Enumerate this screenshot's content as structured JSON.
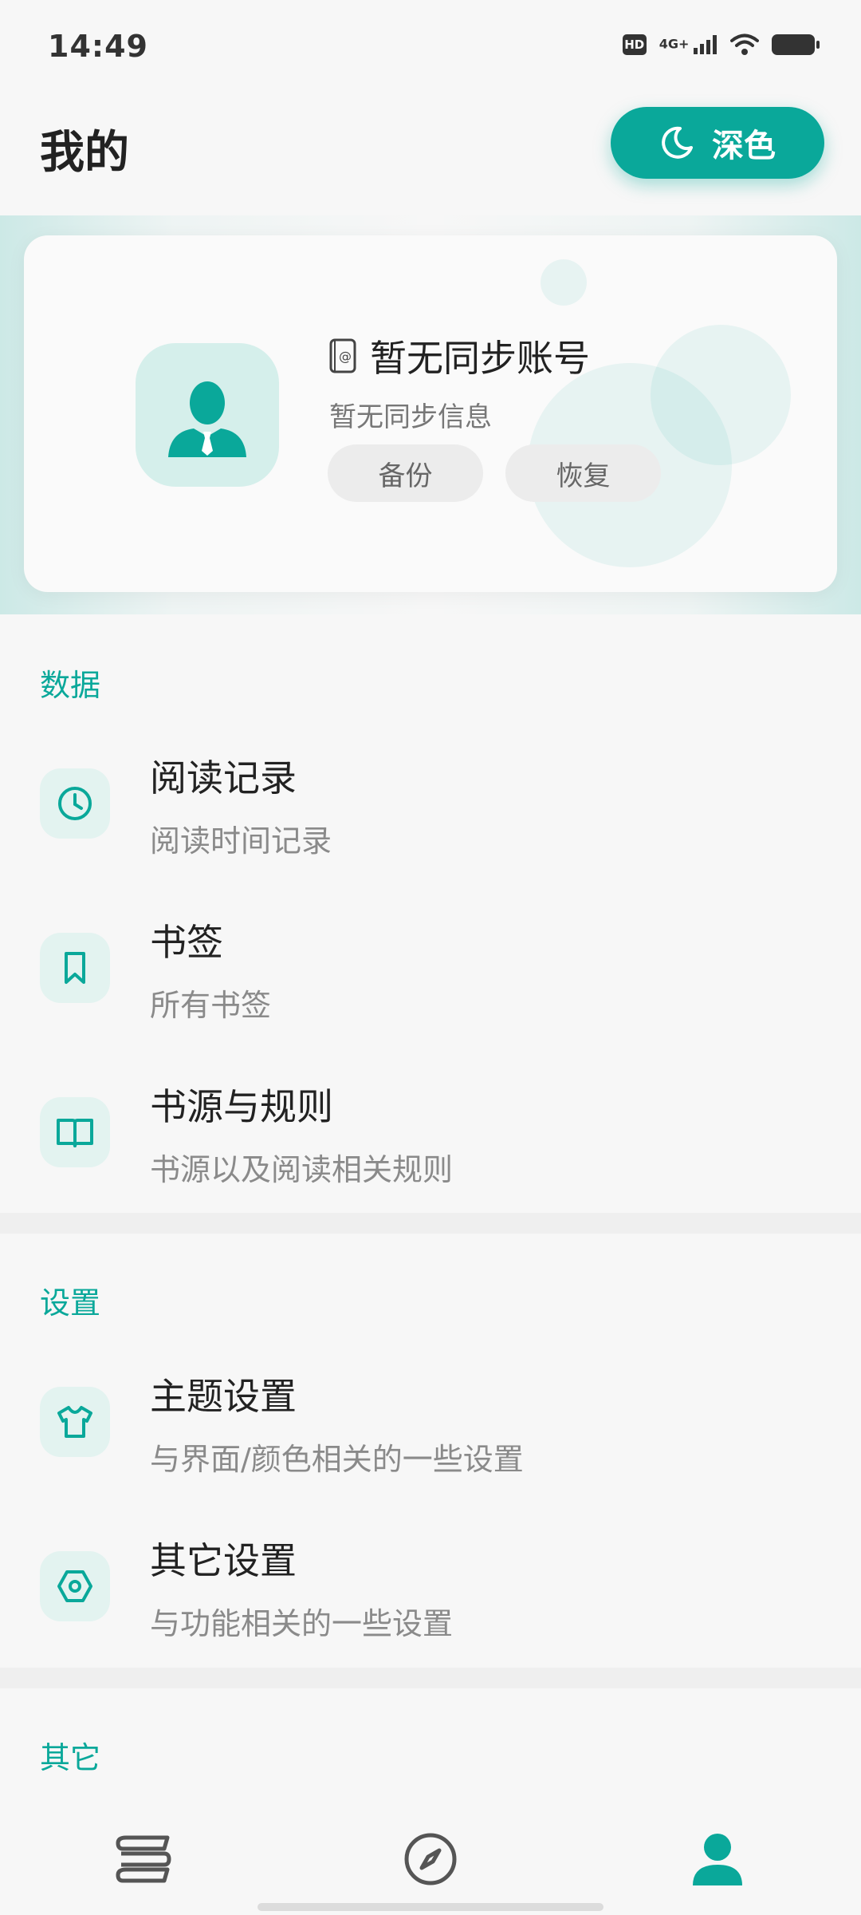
{
  "status_bar": {
    "time": "14:49",
    "hd": "HD",
    "network": "4G+"
  },
  "header": {
    "title": "我的",
    "theme_button": "深色"
  },
  "profile": {
    "account_name": "暂无同步账号",
    "sync_info": "暂无同步信息",
    "backup_label": "备份",
    "restore_label": "恢复"
  },
  "sections": {
    "data": {
      "title": "数据",
      "items": [
        {
          "label": "阅读记录",
          "desc": "阅读时间记录",
          "icon": "clock-icon"
        },
        {
          "label": "书签",
          "desc": "所有书签",
          "icon": "bookmark-icon"
        },
        {
          "label": "书源与规则",
          "desc": "书源以及阅读相关规则",
          "icon": "open-book-icon"
        }
      ]
    },
    "settings": {
      "title": "设置",
      "items": [
        {
          "label": "主题设置",
          "desc": "与界面/颜色相关的一些设置",
          "icon": "tshirt-icon"
        },
        {
          "label": "其它设置",
          "desc": "与功能相关的一些设置",
          "icon": "hex-gear-icon"
        }
      ]
    },
    "other": {
      "title": "其它"
    }
  },
  "bottom_nav": [
    "bookshelf-icon",
    "compass-icon",
    "profile-icon"
  ],
  "colors": {
    "accent": "#0aa89a",
    "icon_bg": "#e3f3f0"
  }
}
